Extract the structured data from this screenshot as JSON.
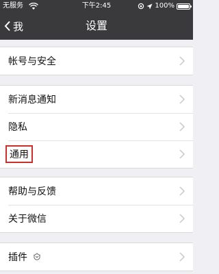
{
  "status_bar": {
    "carrier": "无服务",
    "time": "下午2:45",
    "battery_percent": "100%"
  },
  "nav": {
    "back_label": "我",
    "title": "设置"
  },
  "groups": [
    {
      "items": [
        {
          "label": "帐号与安全"
        }
      ]
    },
    {
      "items": [
        {
          "label": "新消息通知"
        },
        {
          "label": "隐私"
        },
        {
          "label": "通用",
          "highlighted": true
        }
      ]
    },
    {
      "items": [
        {
          "label": "帮助与反馈"
        },
        {
          "label": "关于微信"
        }
      ]
    },
    {
      "items": [
        {
          "label": "插件",
          "icon": "plugin-bulb-icon"
        }
      ]
    }
  ],
  "colors": {
    "nav_background": "#3a3a3d",
    "page_background": "#efeff4",
    "highlight_border": "#c9302c"
  }
}
